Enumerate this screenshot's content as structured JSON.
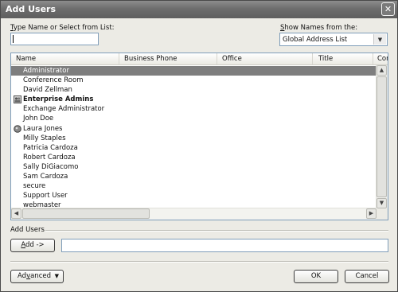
{
  "window": {
    "title": "Add Users",
    "close_glyph": "✕"
  },
  "search": {
    "label": "Type Name or Select from List:",
    "label_mnemonic": "T",
    "label_rest": "ype Name or Select from List:",
    "value": ""
  },
  "show_names": {
    "label_mnemonic": "S",
    "label_rest": "how Names from the:",
    "selected": "Global Address List"
  },
  "list": {
    "columns": [
      "Name",
      "Business Phone",
      "Office",
      "Title",
      "Com"
    ],
    "rows": [
      {
        "name": "Administrator",
        "selected": true,
        "bold": false,
        "icon": ""
      },
      {
        "name": "Conference Room",
        "selected": false,
        "bold": false,
        "icon": ""
      },
      {
        "name": "David Zellman",
        "selected": false,
        "bold": false,
        "icon": ""
      },
      {
        "name": "Enterprise Admins",
        "selected": false,
        "bold": true,
        "icon": "group-icon"
      },
      {
        "name": "Exchange Administrator",
        "selected": false,
        "bold": false,
        "icon": ""
      },
      {
        "name": "John Doe",
        "selected": false,
        "bold": false,
        "icon": ""
      },
      {
        "name": "Laura Jones",
        "selected": false,
        "bold": false,
        "icon": "contact-icon"
      },
      {
        "name": "Milly Staples",
        "selected": false,
        "bold": false,
        "icon": ""
      },
      {
        "name": "Patricia Cardoza",
        "selected": false,
        "bold": false,
        "icon": ""
      },
      {
        "name": "Robert Cardoza",
        "selected": false,
        "bold": false,
        "icon": ""
      },
      {
        "name": "Sally DiGiacomo",
        "selected": false,
        "bold": false,
        "icon": ""
      },
      {
        "name": "Sam Cardoza",
        "selected": false,
        "bold": false,
        "icon": ""
      },
      {
        "name": "secure",
        "selected": false,
        "bold": false,
        "icon": ""
      },
      {
        "name": "Support User",
        "selected": false,
        "bold": false,
        "icon": ""
      },
      {
        "name": "webmaster",
        "selected": false,
        "bold": false,
        "icon": ""
      }
    ]
  },
  "add_users": {
    "group_label": "Add Users",
    "add_mnemonic": "A",
    "add_rest": "dd ->",
    "value": ""
  },
  "buttons": {
    "advanced_pre": "Ad",
    "advanced_mnemonic": "v",
    "advanced_post": "anced",
    "ok": "OK",
    "cancel": "Cancel"
  },
  "icons": {
    "scroll_up": "▲",
    "scroll_down": "▼",
    "scroll_left": "◀",
    "scroll_right": "▶",
    "dropdown": "▼"
  },
  "colors": {
    "selection": "#7e7e7e",
    "title_bar": "#6d6d6d",
    "dialog_bg": "#ecebe5"
  }
}
